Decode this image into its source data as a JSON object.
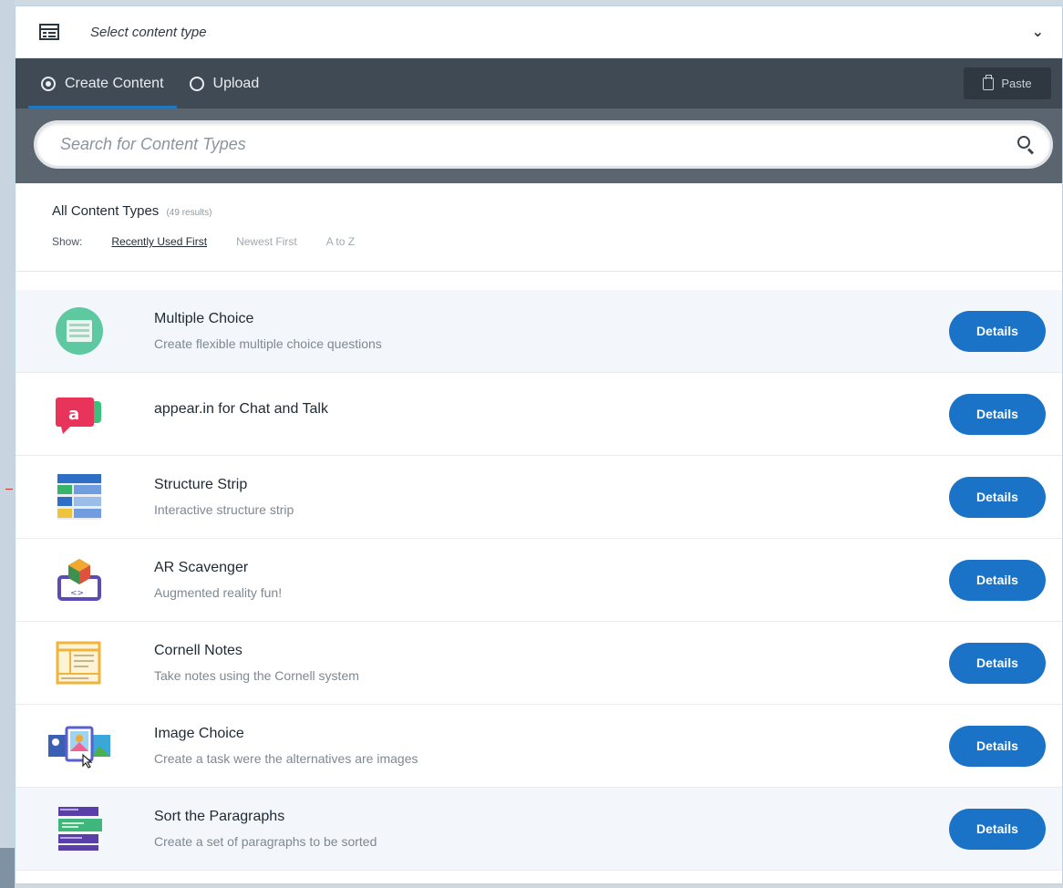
{
  "select": {
    "label": "Select content type",
    "icon": "content-type-icon"
  },
  "tabs": [
    {
      "label": "Create Content",
      "selected": true
    },
    {
      "label": "Upload",
      "selected": false
    }
  ],
  "paste": {
    "label": "Paste",
    "icon": "clipboard-icon"
  },
  "search": {
    "placeholder": "Search for Content Types",
    "value": ""
  },
  "results": {
    "title": "All Content Types",
    "count": "(49 results)",
    "show_label": "Show:",
    "sort_options": [
      "Recently Used First",
      "Newest First",
      "A to Z"
    ],
    "active_sort": "Recently Used First"
  },
  "items": [
    {
      "title": "Multiple Choice",
      "summary": "Create flexible multiple choice questions",
      "button": "Details",
      "icon": "multiple-choice-icon"
    },
    {
      "title": "appear.in for Chat and Talk",
      "summary": "",
      "button": "Details",
      "icon": "appear-in-icon"
    },
    {
      "title": "Structure Strip",
      "summary": "Interactive structure strip",
      "button": "Details",
      "icon": "structure-strip-icon"
    },
    {
      "title": "AR Scavenger",
      "summary": "Augmented reality fun!",
      "button": "Details",
      "icon": "ar-scavenger-icon"
    },
    {
      "title": "Cornell Notes",
      "summary": "Take notes using the Cornell system",
      "button": "Details",
      "icon": "cornell-notes-icon"
    },
    {
      "title": "Image Choice",
      "summary": "Create a task were the alternatives are images",
      "button": "Details",
      "icon": "image-choice-icon"
    },
    {
      "title": "Sort the Paragraphs",
      "summary": "Create a set of paragraphs to be sorted",
      "button": "Details",
      "icon": "sort-paragraphs-icon"
    }
  ],
  "colors": {
    "accent": "#1a73c7",
    "toolbar": "#3f4a55",
    "search_band": "#5a6570"
  }
}
